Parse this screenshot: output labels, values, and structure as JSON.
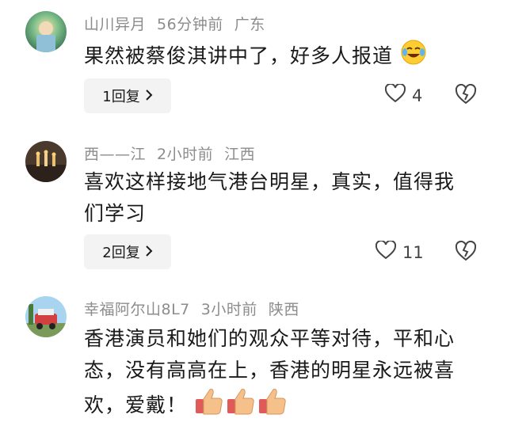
{
  "comments": [
    {
      "user": "山川异月",
      "time": "56分钟前",
      "location": "广东",
      "text": "果然被蔡俊淇讲中了，好多人报道",
      "reply_label": "1回复",
      "likes": "4",
      "emoji": "crying-laughing-emoji"
    },
    {
      "user": "西——江",
      "time": "2小时前",
      "location": "江西",
      "text": "喜欢这样接地气港台明星，真实，值得我们学习",
      "reply_label": "2回复",
      "likes": "11"
    },
    {
      "user": "幸福阿尔山8L7",
      "time": "3小时前",
      "location": "陕西",
      "text": "香港演员和她们的观众平等对待，平和心态，没有高高在上，香港的明星永远被喜欢，爱戴！",
      "emoji": "thumbs-up-emoji"
    }
  ],
  "icons": {
    "like": "heart-outline-icon",
    "dislike": "broken-heart-icon",
    "chevron": "chevron-right-icon"
  }
}
